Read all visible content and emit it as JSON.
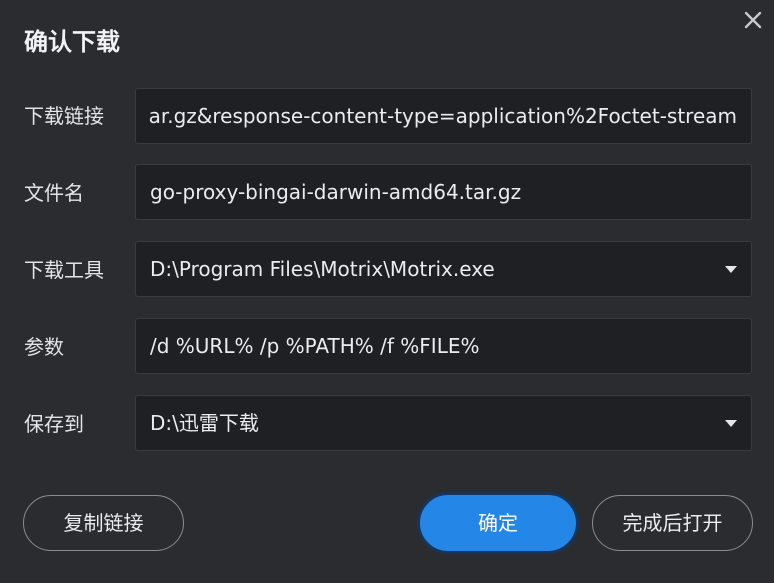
{
  "dialog": {
    "title": "确认下载",
    "close_icon": "close-icon"
  },
  "fields": {
    "url": {
      "label": "下载链接",
      "value": "ar.gz&response-content-type=application%2Foctet-stream"
    },
    "filename": {
      "label": "文件名",
      "value": "go-proxy-bingai-darwin-amd64.tar.gz"
    },
    "tool": {
      "label": "下载工具",
      "value": "D:\\Program Files\\Motrix\\Motrix.exe"
    },
    "params": {
      "label": "参数",
      "value": "/d %URL% /p %PATH% /f %FILE%"
    },
    "save_to": {
      "label": "保存到",
      "value": "D:\\迅雷下载"
    }
  },
  "buttons": {
    "copy_link": "复制链接",
    "confirm": "确定",
    "open_after": "完成后打开"
  },
  "colors": {
    "background": "#2b2c30",
    "field_background": "#1f2023",
    "primary": "#2486e6"
  }
}
